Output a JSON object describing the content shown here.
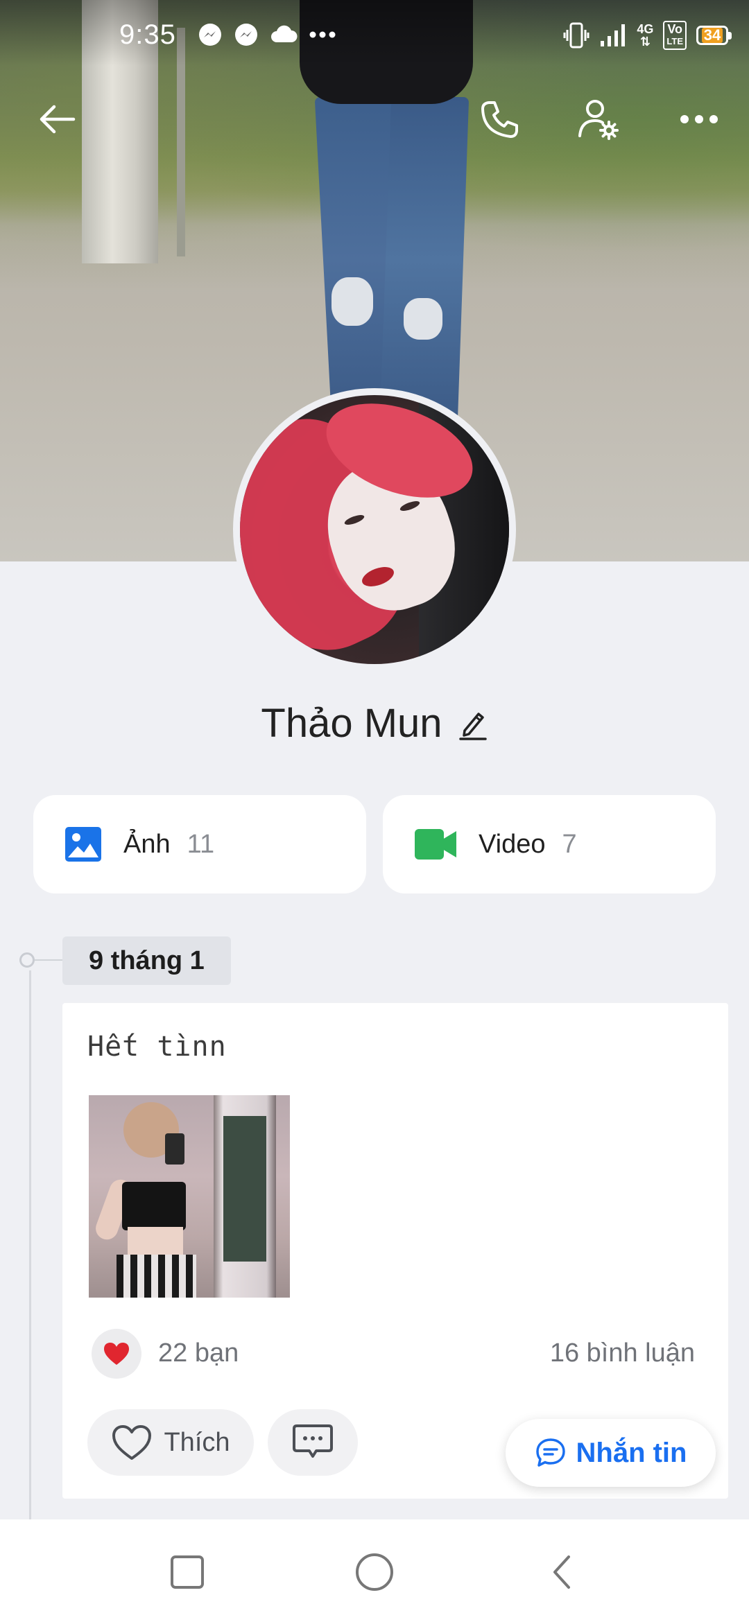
{
  "status_bar": {
    "time": "9:35",
    "network_top": "4G",
    "volte_top": "Vo",
    "volte_bottom": "LTE",
    "battery": "34",
    "icons": [
      "messenger-icon",
      "messenger-icon",
      "cloud-icon",
      "more-dots-icon",
      "vibrate-icon",
      "signal-icon",
      "4g-icon",
      "volte-icon",
      "battery-icon"
    ]
  },
  "header": {
    "back_icon": "back-arrow-icon",
    "call_icon": "phone-icon",
    "settings_icon": "user-settings-icon",
    "more_icon": "more-icon"
  },
  "profile": {
    "name": "Thảo Mun"
  },
  "media": {
    "photos_label": "Ảnh",
    "photos_count": "11",
    "videos_label": "Video",
    "videos_count": "7"
  },
  "timeline": {
    "date": "9 tháng 1"
  },
  "post": {
    "text": "Hết tìnn",
    "likes": "22 bạn",
    "comments": "16 bình luận",
    "like_label": "Thích"
  },
  "message_button": {
    "label": "Nhắn tin"
  },
  "colors": {
    "accent": "#1a6ff0",
    "photo_icon": "#1a73e8",
    "video_icon": "#2fb55b",
    "background": "#eff0f4",
    "heart": "#e0262f"
  }
}
